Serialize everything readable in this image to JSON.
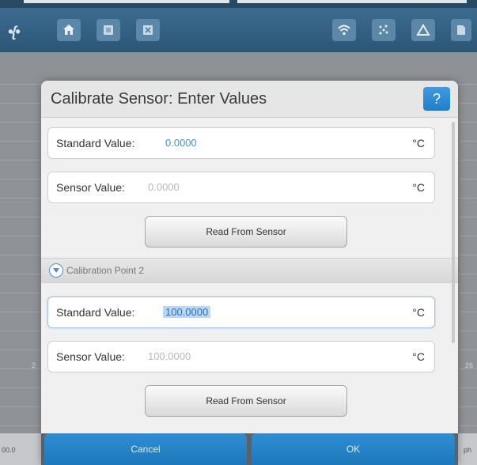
{
  "app": {
    "logo_text": "•{•",
    "left_edge_value": "2",
    "right_edge_value": "26",
    "bottom_left_value": "00.0",
    "bottom_right_value": "ph",
    "toolbar_icons": [
      "home-icon",
      "export-icon",
      "close-doc-icon",
      "wifi-icon",
      "dots-icon",
      "graph-icon",
      "document-icon"
    ]
  },
  "dialog": {
    "title": "Calibrate Sensor: Enter Values",
    "help_label": "?",
    "point1": {
      "standard_label": "Standard Value:",
      "standard_value": "0.0000",
      "standard_unit": "°C",
      "sensor_label": "Sensor Value:",
      "sensor_value": "0.0000",
      "sensor_unit": "°C",
      "read_button": "Read From Sensor"
    },
    "section2_title": "Calibration Point 2",
    "point2": {
      "standard_label": "Standard Value:",
      "standard_value": "100.0000",
      "standard_unit": "°C",
      "sensor_label": "Sensor Value:",
      "sensor_value": "100.0000",
      "sensor_unit": "°C",
      "read_button": "Read From Sensor"
    },
    "cancel_label": "Cancel",
    "ok_label": "OK"
  },
  "colors": {
    "accent": "#1e7fca",
    "toolbar": "#2b5676"
  }
}
